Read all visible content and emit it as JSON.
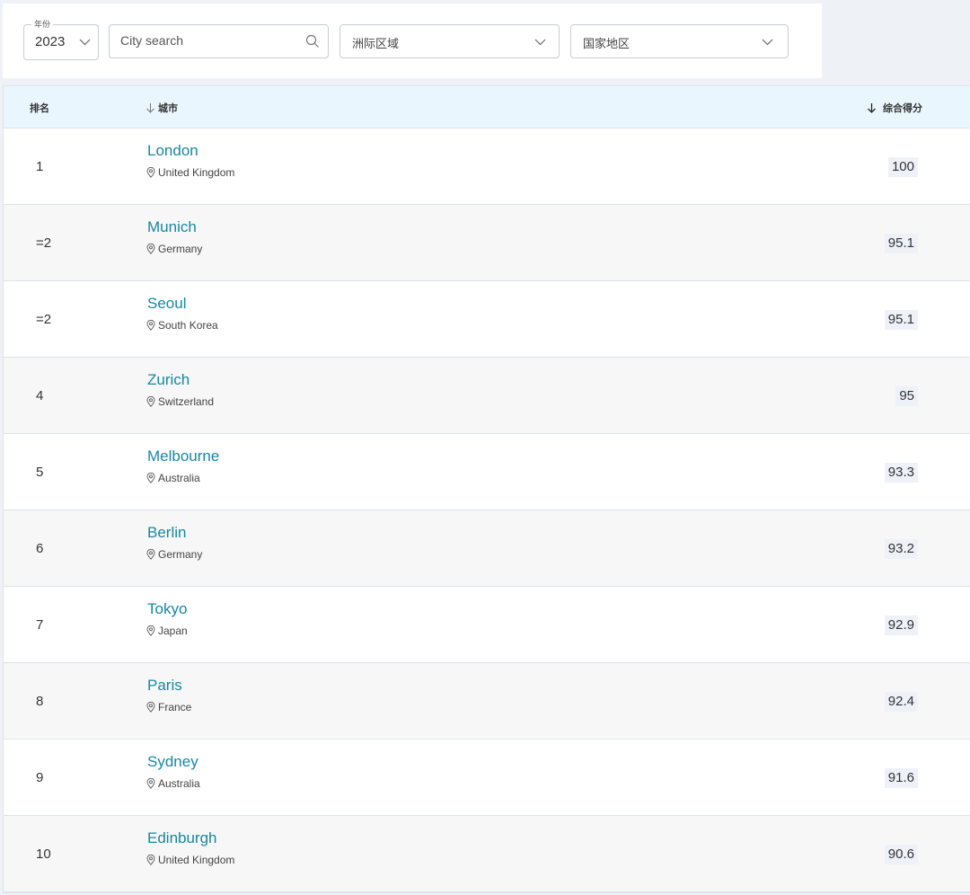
{
  "filters": {
    "year_label": "年份",
    "year_value": "2023",
    "search_placeholder": "City search",
    "region_label": "洲际区域",
    "country_label": "国家地区"
  },
  "table": {
    "headers": {
      "rank": "排名",
      "city": "城市",
      "score": "综合得分"
    },
    "rows": [
      {
        "rank": "1",
        "city": "London",
        "country": "United Kingdom",
        "score": "100"
      },
      {
        "rank": "=2",
        "city": "Munich",
        "country": "Germany",
        "score": "95.1"
      },
      {
        "rank": "=2",
        "city": "Seoul",
        "country": "South Korea",
        "score": "95.1"
      },
      {
        "rank": "4",
        "city": "Zurich",
        "country": "Switzerland",
        "score": "95"
      },
      {
        "rank": "5",
        "city": "Melbourne",
        "country": "Australia",
        "score": "93.3"
      },
      {
        "rank": "6",
        "city": "Berlin",
        "country": "Germany",
        "score": "93.2"
      },
      {
        "rank": "7",
        "city": "Tokyo",
        "country": "Japan",
        "score": "92.9"
      },
      {
        "rank": "8",
        "city": "Paris",
        "country": "France",
        "score": "92.4"
      },
      {
        "rank": "9",
        "city": "Sydney",
        "country": "Australia",
        "score": "91.6"
      },
      {
        "rank": "10",
        "city": "Edinburgh",
        "country": "United Kingdom",
        "score": "90.6"
      }
    ]
  },
  "colors": {
    "link": "#1787a5",
    "header_bg": "#eaf6fd",
    "alt_row": "#f7f7f7",
    "score_bg": "#eef1f8"
  },
  "icons": {
    "dropdown": "chevron-down-icon",
    "search": "search-icon",
    "location": "location-pin-icon",
    "sort": "arrow-down-icon"
  }
}
